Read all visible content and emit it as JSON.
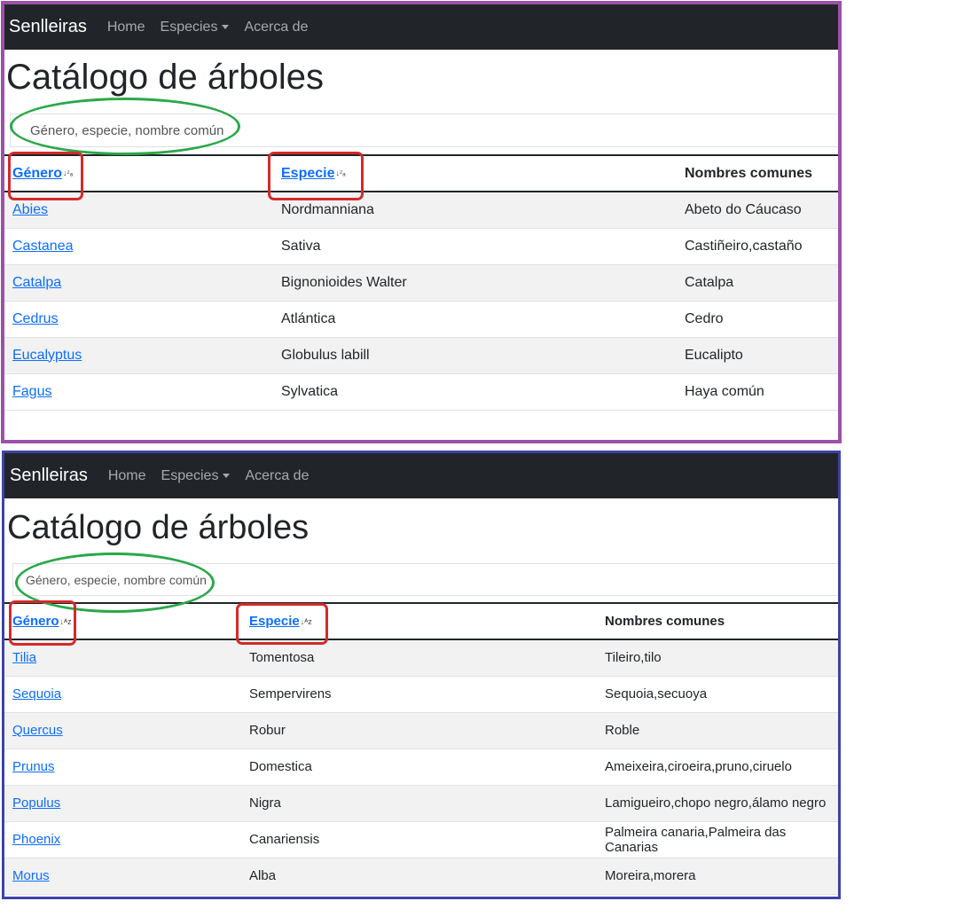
{
  "colors": {
    "panel_a_border": "#9b52a8",
    "panel_b_border": "#3d43a8",
    "navbar_bg": "#212529",
    "link": "#0d6efd",
    "highlight_red": "#d42a2a",
    "highlight_green": "#2aa84a"
  },
  "panel_a": {
    "navbar": {
      "brand": "Senlleiras",
      "home": "Home",
      "especies": "Especies",
      "acerca": "Acerca de"
    },
    "title": "Catálogo de árboles",
    "search_placeholder": "Género, especie, nombre común",
    "headers": {
      "genero": "Género",
      "especie": "Especie",
      "nombres": "Nombres comunes",
      "genero_sort": "↓ᶻₐ",
      "especie_sort": "↓ᶻₐ"
    },
    "rows": [
      {
        "genero": "Abies",
        "especie": "Nordmanniana",
        "nombres": "Abeto do Cáucaso"
      },
      {
        "genero": "Castanea",
        "especie": "Sativa",
        "nombres": "Castiñeiro,castaño"
      },
      {
        "genero": "Catalpa",
        "especie": "Bignonioides Walter",
        "nombres": "Catalpa"
      },
      {
        "genero": "Cedrus",
        "especie": "Atlántica",
        "nombres": "Cedro"
      },
      {
        "genero": "Eucalyptus",
        "especie": "Globulus labill",
        "nombres": "Eucalipto"
      },
      {
        "genero": "Fagus",
        "especie": "Sylvatica",
        "nombres": "Haya común"
      }
    ]
  },
  "panel_b": {
    "navbar": {
      "brand": "Senlleiras",
      "home": "Home",
      "especies": "Especies",
      "acerca": "Acerca de"
    },
    "title": "Catálogo de árboles",
    "search_placeholder": "Género, especie, nombre común",
    "headers": {
      "genero": "Género",
      "especie": "Especie",
      "nombres": "Nombres comunes",
      "genero_sort": "↓ᴬz",
      "especie_sort": "↓ᴬz"
    },
    "rows": [
      {
        "genero": "Tilia",
        "especie": "Tomentosa",
        "nombres": "Tileiro,tilo"
      },
      {
        "genero": "Sequoia",
        "especie": "Sempervirens",
        "nombres": "Sequoia,secuoya"
      },
      {
        "genero": "Quercus",
        "especie": "Robur",
        "nombres": "Roble"
      },
      {
        "genero": "Prunus",
        "especie": "Domestica",
        "nombres": "Ameixeira,ciroeira,pruno,ciruelo"
      },
      {
        "genero": "Populus",
        "especie": "Nigra",
        "nombres": "Lamigueiro,chopo negro,álamo negro"
      },
      {
        "genero": "Phoenix",
        "especie": "Canariensis",
        "nombres": "Palmeira canaria,Palmeira das Canarias"
      },
      {
        "genero": "Morus",
        "especie": "Alba",
        "nombres": "Moreira,morera"
      }
    ]
  }
}
